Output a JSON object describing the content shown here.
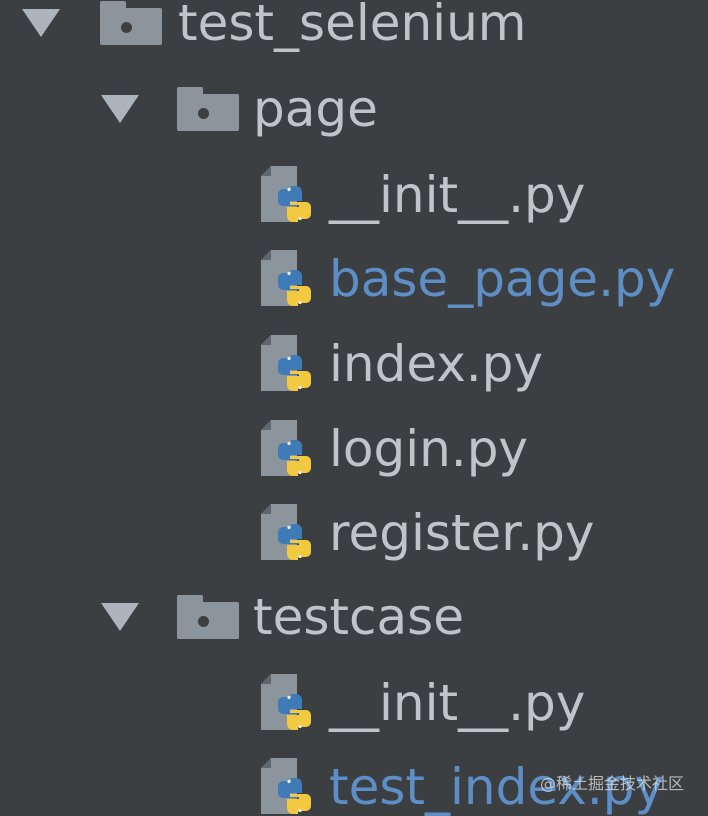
{
  "tree": {
    "root": {
      "label": "test_selenium",
      "expanded": true,
      "icon": "folder-icon"
    },
    "page_folder": {
      "label": "page",
      "expanded": true,
      "icon": "folder-icon",
      "files": [
        {
          "label": "__init__.py",
          "status": "normal",
          "icon": "python-file-icon"
        },
        {
          "label": "base_page.py",
          "status": "modified",
          "icon": "python-file-icon"
        },
        {
          "label": "index.py",
          "status": "normal",
          "icon": "python-file-icon"
        },
        {
          "label": "login.py",
          "status": "normal",
          "icon": "python-file-icon"
        },
        {
          "label": "register.py",
          "status": "normal",
          "icon": "python-file-icon"
        }
      ]
    },
    "testcase_folder": {
      "label": "testcase",
      "expanded": true,
      "icon": "folder-icon",
      "files": [
        {
          "label": "__init__.py",
          "status": "normal",
          "icon": "python-file-icon"
        },
        {
          "label": "test_index.py",
          "status": "modified",
          "icon": "python-file-icon"
        }
      ]
    }
  },
  "colors": {
    "background": "#3c3f41",
    "text_normal": "#bfc4c9",
    "text_modified": "#5e8ec6",
    "icon_gray": "#8c959c",
    "python_blue": "#3f7bb6",
    "python_yellow": "#f3c93f"
  },
  "watermark": "@稀土掘金技术社区"
}
